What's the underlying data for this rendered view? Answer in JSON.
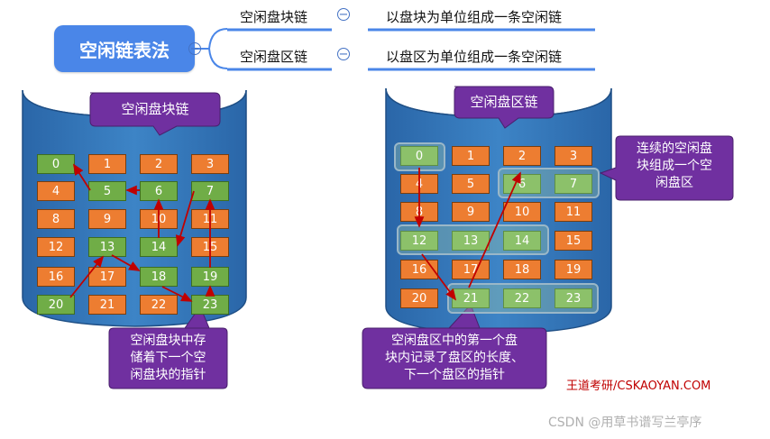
{
  "mindmap": {
    "root": "空闲链表法",
    "branches": [
      {
        "name": "空闲盘块链",
        "desc": "以盘块为单位组成一条空闲链"
      },
      {
        "name": "空闲盘区链",
        "desc": "以盘区为单位组成一条空闲链"
      }
    ]
  },
  "left_diagram": {
    "title": "空闲盘块链",
    "grid": [
      [
        "0",
        "1",
        "2",
        "3"
      ],
      [
        "4",
        "5",
        "6",
        "7"
      ],
      [
        "8",
        "9",
        "10",
        "11"
      ],
      [
        "12",
        "13",
        "14",
        "15"
      ],
      [
        "16",
        "17",
        "18",
        "19"
      ],
      [
        "20",
        "21",
        "22",
        "23"
      ]
    ],
    "free_blocks": [
      "0",
      "5",
      "6",
      "7",
      "13",
      "14",
      "18",
      "19",
      "20",
      "23"
    ],
    "callout": [
      "空闲盘块中存",
      "储着下一个空",
      "闲盘块的指针"
    ]
  },
  "right_diagram": {
    "title": "空闲盘区链",
    "grid": [
      [
        "0",
        "1",
        "2",
        "3"
      ],
      [
        "4",
        "5",
        "6",
        "7"
      ],
      [
        "8",
        "9",
        "10",
        "11"
      ],
      [
        "12",
        "13",
        "14",
        "15"
      ],
      [
        "16",
        "17",
        "18",
        "19"
      ],
      [
        "20",
        "21",
        "22",
        "23"
      ]
    ],
    "free_blocks": [
      "0",
      "6",
      "7",
      "12",
      "13",
      "14",
      "21",
      "22",
      "23"
    ],
    "callout_top": [
      "连续的空闲盘",
      "块组成一个空",
      "闲盘区"
    ],
    "callout_bottom": [
      "空闲盘区中的第一个盘",
      "块内记录了盘区的长度、",
      "下一个盘区的指针"
    ]
  },
  "footer": "王道考研/CSKAOYAN.COM",
  "credit": "CSDN @用草书谱写兰亭序",
  "colors": {
    "accent": "#4a86e8",
    "free": "#70ad47",
    "used": "#ed7d31",
    "callout": "#7030a0",
    "disk": "#2e75b6"
  }
}
